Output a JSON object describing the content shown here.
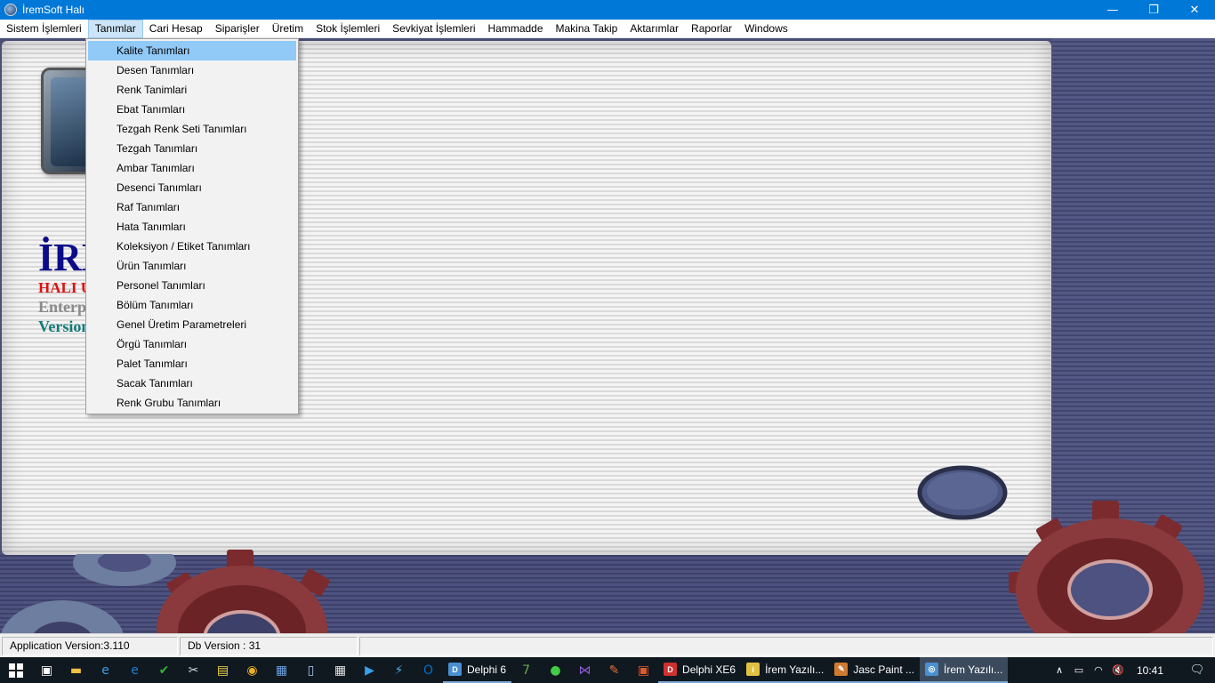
{
  "window": {
    "title": "İremSoft Halı",
    "controls": {
      "minimize": "—",
      "restore": "❐",
      "close": "✕"
    }
  },
  "menubar": {
    "items": [
      {
        "label": "Sistem İşlemleri",
        "active": false
      },
      {
        "label": "Tanımlar",
        "active": true
      },
      {
        "label": "Cari Hesap",
        "active": false
      },
      {
        "label": "Siparişler",
        "active": false
      },
      {
        "label": "Üretim",
        "active": false
      },
      {
        "label": "Stok İşlemleri",
        "active": false
      },
      {
        "label": "Sevkiyat İşlemleri",
        "active": false
      },
      {
        "label": "Hammadde",
        "active": false
      },
      {
        "label": "Makina Takip",
        "active": false
      },
      {
        "label": "Aktarımlar",
        "active": false
      },
      {
        "label": "Raporlar",
        "active": false
      },
      {
        "label": "Windows",
        "active": false
      }
    ]
  },
  "dropdown": {
    "items": [
      {
        "label": "Kalite Tanımları",
        "highlighted": true
      },
      {
        "label": "Desen Tanımları"
      },
      {
        "label": "Renk Tanimlari"
      },
      {
        "label": "Ebat Tanımları"
      },
      {
        "label": "Tezgah Renk Seti Tanımları"
      },
      {
        "label": "Tezgah Tanımları"
      },
      {
        "label": "Ambar Tanımları"
      },
      {
        "label": "Desenci Tanımları"
      },
      {
        "label": "Raf Tanımları"
      },
      {
        "label": "Hata Tanımları"
      },
      {
        "label": "Koleksiyon / Etiket Tanımları"
      },
      {
        "label": "Ürün Tanımları"
      },
      {
        "label": "Personel Tanımları"
      },
      {
        "label": "Bölüm Tanımları"
      },
      {
        "label": "Genel Üretim Parametreleri"
      },
      {
        "label": "Örgü Tanımları"
      },
      {
        "label": "Palet Tanımları"
      },
      {
        "label": "Sacak Tanımları"
      },
      {
        "label": "Renk Grubu Tanımları"
      }
    ]
  },
  "splash": {
    "line1": "İRE",
    "line2": "HALI U",
    "line3": "Enterp",
    "line4": "Version"
  },
  "statusbar": {
    "app_version": "Application Version:3.110",
    "db_version": "Db Version : 31"
  },
  "taskbar": {
    "pinned": [
      {
        "icon": "task-view-icon",
        "glyph": "▣",
        "color": "#ffffff"
      },
      {
        "icon": "file-explorer-icon",
        "glyph": "▬",
        "color": "#f0c040"
      },
      {
        "icon": "internet-explorer-icon",
        "glyph": "e",
        "color": "#3aa0e8"
      },
      {
        "icon": "edge-icon",
        "glyph": "e",
        "color": "#1f7fd6"
      },
      {
        "icon": "green-app-icon",
        "glyph": "✔",
        "color": "#2eb82e"
      },
      {
        "icon": "tool-icon",
        "glyph": "✂",
        "color": "#d9d9d9"
      },
      {
        "icon": "notes-icon",
        "glyph": "▤",
        "color": "#f5d547"
      },
      {
        "icon": "chrome-icon",
        "glyph": "◉",
        "color": "#e8b020"
      },
      {
        "icon": "network-app-icon",
        "glyph": "▦",
        "color": "#6aa0e0"
      },
      {
        "icon": "document-icon",
        "glyph": "▯",
        "color": "#a8c8f0"
      },
      {
        "icon": "calculator-icon",
        "glyph": "▦",
        "color": "#e0e0e0"
      },
      {
        "icon": "media-player-icon",
        "glyph": "▶",
        "color": "#3aa0e8"
      },
      {
        "icon": "lightning-icon",
        "glyph": "⚡",
        "color": "#4ab0f0"
      },
      {
        "icon": "outlook-icon",
        "glyph": "O",
        "color": "#0072c6"
      }
    ],
    "apps_group_1": [
      {
        "label": "Delphi 6",
        "icon": "delphi6-icon",
        "color": "#4a8fd0",
        "glyph": "D",
        "active": false
      }
    ],
    "pinned_2": [
      {
        "icon": "seven-zip-icon",
        "glyph": "7",
        "color": "#6aa84f"
      },
      {
        "icon": "green-orb-icon",
        "glyph": "●",
        "color": "#44cc44"
      },
      {
        "icon": "visual-studio-icon",
        "glyph": "⋈",
        "color": "#8e5ad6"
      },
      {
        "icon": "paint-icon",
        "glyph": "✎",
        "color": "#e07040"
      },
      {
        "icon": "window-app-icon",
        "glyph": "▣",
        "color": "#e05a2a"
      }
    ],
    "apps_group_2": [
      {
        "label": "Delphi XE6",
        "icon": "delphi-xe6-icon",
        "color": "#d03030",
        "glyph": "D",
        "active": false
      },
      {
        "label": "İrem Yazılı...",
        "icon": "irem-info-icon",
        "color": "#e0c040",
        "glyph": "i",
        "active": false
      },
      {
        "label": "Jasc Paint ...",
        "icon": "jasc-paint-icon",
        "color": "#d07a30",
        "glyph": "✎",
        "active": false
      },
      {
        "label": "İrem Yazılı...",
        "icon": "irem-app-icon",
        "color": "#4a8fd0",
        "glyph": "◎",
        "active": true
      }
    ],
    "tray": {
      "icons": [
        {
          "icon": "chevron-up-icon",
          "glyph": "∧"
        },
        {
          "icon": "battery-icon",
          "glyph": "▭"
        },
        {
          "icon": "wifi-icon",
          "glyph": "◠"
        },
        {
          "icon": "volume-muted-icon",
          "glyph": "🔇"
        }
      ],
      "time": "10:41",
      "notification_glyph": "🗨"
    }
  }
}
